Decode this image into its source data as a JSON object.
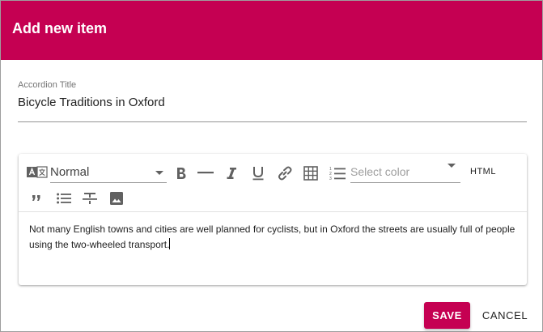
{
  "dialog": {
    "title": "Add new item",
    "header_color": "#c50052"
  },
  "title_field": {
    "label": "Accordion Title",
    "value": "Bicycle Traditions in Oxford"
  },
  "toolbar": {
    "format_select": {
      "value": "Normal",
      "icon": "translate-icon"
    },
    "color_select": {
      "placeholder": "Select color"
    },
    "html_label": "HTML",
    "icons": [
      "bold-icon",
      "horizontal-rule-icon",
      "italic-icon",
      "underline-icon",
      "link-icon",
      "table-icon",
      "ordered-list-icon",
      "quote-icon",
      "bullet-list-icon",
      "strikethrough-icon",
      "image-icon"
    ]
  },
  "editor": {
    "content": "Not many English towns and cities are well planned for cyclists, but in Oxford the streets are usually full of people using the two-wheeled transport."
  },
  "actions": {
    "save_label": "SAVE",
    "cancel_label": "CANCEL"
  }
}
